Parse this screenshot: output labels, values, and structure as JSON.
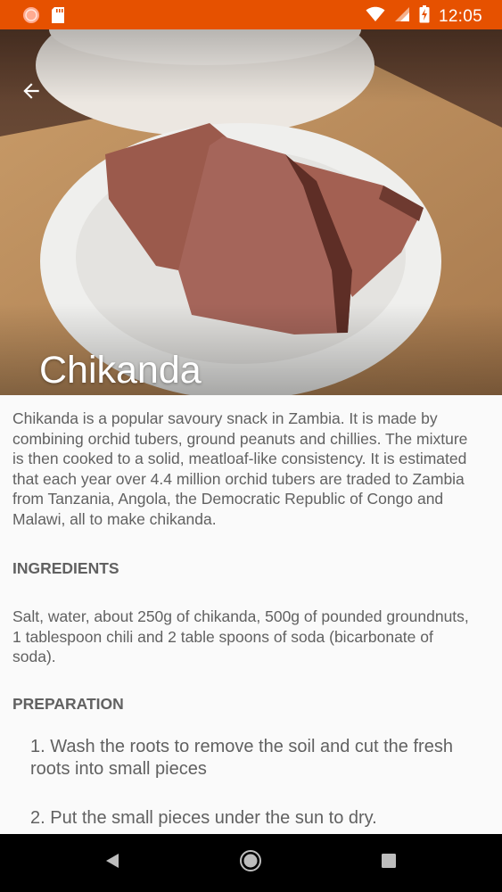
{
  "status_bar": {
    "time": "12:05",
    "icons": [
      "notification-icon",
      "sd-card-icon",
      "wifi-icon",
      "signal-icon",
      "battery-charging-icon"
    ],
    "background": "#e65100"
  },
  "hero": {
    "title": "Chikanda",
    "back_icon": "arrow-back-icon"
  },
  "description": "Chikanda is a popular savoury snack in Zambia. It is made by combining orchid tubers, ground peanuts and chillies. The mixture is then cooked to a solid, meatloaf-like consistency. It is estimated that each year over 4.4 million orchid tubers are traded to Zambia from Tanzania, Angola, the Democratic Republic of Congo and Malawi, all to make chikanda.",
  "ingredients": {
    "heading": "INGREDIENTS",
    "text": "Salt, water, about 250g of chikanda, 500g of pounded groundnuts, 1 tablespoon chili and 2 table spoons of soda (bicarbonate of soda)."
  },
  "preparation": {
    "heading": "PREPARATION",
    "steps": [
      "1. Wash the roots to remove the soil and cut the fresh roots into small pieces",
      "2. Put the small pieces under the sun to dry."
    ]
  },
  "nav_bar": {
    "icons": [
      "back-triangle-icon",
      "home-circle-icon",
      "recents-square-icon"
    ]
  }
}
